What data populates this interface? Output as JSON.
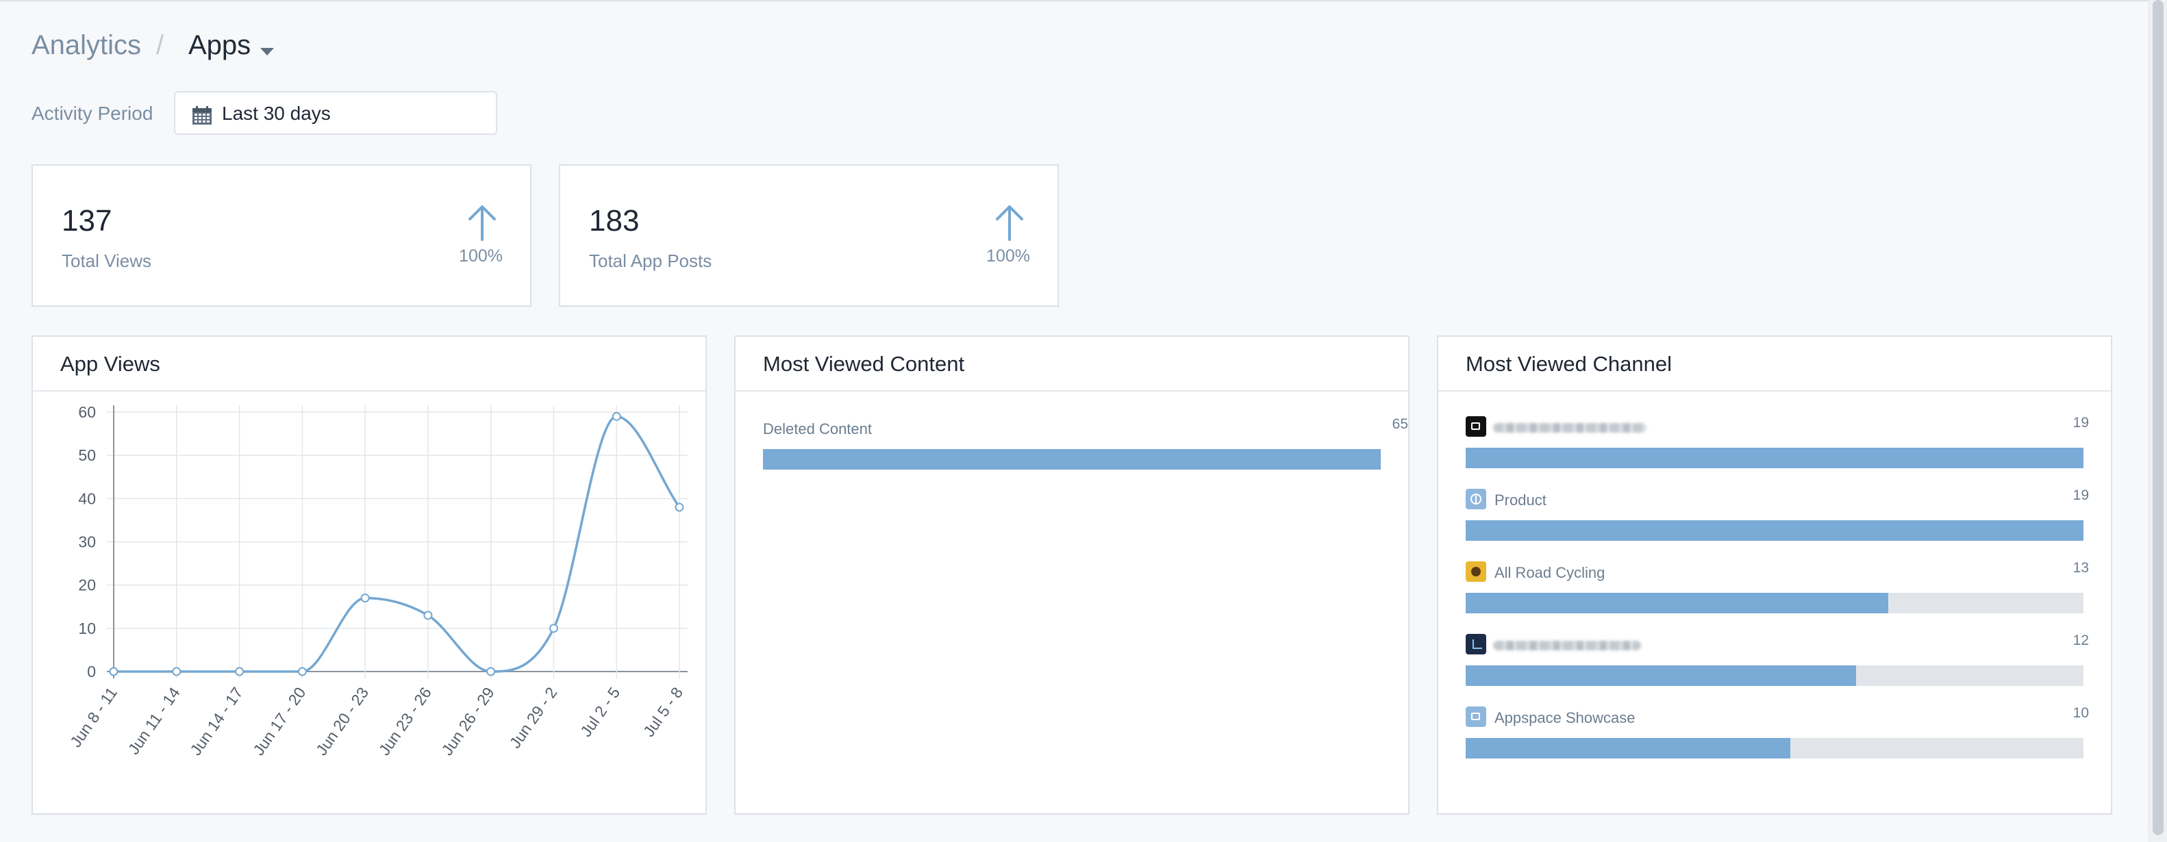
{
  "breadcrumb": {
    "root": "Analytics",
    "separator": "/",
    "current": "Apps"
  },
  "activity_period": {
    "label": "Activity Period",
    "value": "Last 30 days"
  },
  "stats": [
    {
      "value": "137",
      "label": "Total Views",
      "change": "100%"
    },
    {
      "value": "183",
      "label": "Total App Posts",
      "change": "100%"
    }
  ],
  "panels": {
    "app_views": {
      "title": "App Views"
    },
    "most_viewed_content": {
      "title": "Most Viewed Content",
      "items": [
        {
          "label": "Deleted Content",
          "value": "65",
          "fraction": 1.0
        }
      ]
    },
    "most_viewed_channel": {
      "title": "Most Viewed Channel",
      "items": [
        {
          "label": "",
          "value": "19",
          "fraction": 1.0,
          "icon": "app-dark-icon",
          "blurred": true
        },
        {
          "label": "Product",
          "value": "19",
          "fraction": 1.0,
          "icon": "globe-icon",
          "blurred": false
        },
        {
          "label": "All Road Cycling",
          "value": "13",
          "fraction": 0.684,
          "icon": "sunflower-icon",
          "blurred": false
        },
        {
          "label": "",
          "value": "12",
          "fraction": 0.632,
          "icon": "chart-thumb-icon",
          "blurred": true
        },
        {
          "label": "Appspace Showcase",
          "value": "10",
          "fraction": 0.526,
          "icon": "app-light-icon",
          "blurred": false
        }
      ]
    }
  },
  "colors": {
    "accent": "#7aaad6",
    "line": "#74a7d1",
    "track": "#e1e5ea"
  },
  "chart_data": {
    "type": "line",
    "title": "App Views",
    "categories": [
      "Jun 8 - 11",
      "Jun 11 - 14",
      "Jun 14 - 17",
      "Jun 17 - 20",
      "Jun 20 - 23",
      "Jun 23 - 26",
      "Jun 26 - 29",
      "Jun 29 - 2",
      "Jul 2 - 5",
      "Jul 5 - 8"
    ],
    "series": [
      {
        "values": [
          0,
          0,
          0,
          0,
          17,
          13,
          0,
          10,
          59,
          38
        ]
      }
    ],
    "ylim": [
      0,
      60
    ],
    "yticks": [
      0,
      10,
      20,
      30,
      40,
      50,
      60
    ],
    "grid": true,
    "xlabel": "",
    "ylabel": ""
  }
}
